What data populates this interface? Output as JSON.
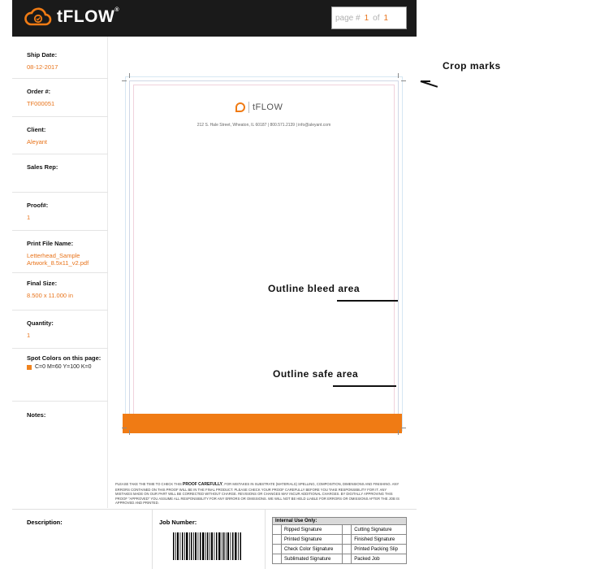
{
  "header": {
    "brand": "tFLOW",
    "page_label": "page #",
    "page_current": "1",
    "page_of_label": "of",
    "page_total": "1"
  },
  "sidebar": {
    "ship_date_label": "Ship Date:",
    "ship_date": "08-12-2017",
    "order_label": "Order #:",
    "order": "TF000051",
    "client_label": "Client:",
    "client": "Aleyant",
    "sales_rep_label": "Sales Rep:",
    "sales_rep": "",
    "proof_label": "Proof#:",
    "proof": "1",
    "print_file_label": "Print File Name:",
    "print_file_line1": "Letterhead_Sample",
    "print_file_line2": "Artwork_8.5x11_v2.pdf",
    "final_size_label": "Final Size:",
    "final_size": "8.500 x 11.000 in",
    "quantity_label": "Quantity:",
    "quantity": "1",
    "spot_label": "Spot Colors on this page:",
    "spot_value": "C=0 M=60 Y=100 K=0",
    "notes_label": "Notes:"
  },
  "document": {
    "brand": "tFLOW",
    "address": "212 S. Hale Street, Wheaton, IL 60187  |  800.571.2139  |  info@aleyant.com"
  },
  "annotations": {
    "crop_marks": "Crop marks",
    "bleed": "Outline bleed area",
    "safe": "Outline safe area"
  },
  "disclaimer": {
    "intro": "Please take the time to check this",
    "emph": "PROOF CAREFULLY",
    "body": ", for mistakes in substrate (materials) spelling, composition, dimensions and finishing. Any errors contained on this proof will be in the final product. Please check your proof carefully before you take responsibility for it. Any mistakes made on our part will be corrected without charge. Revisions or changes may incur additional charges. By digitally approving this proof \"Approved\" you assume all responsibility for any errors or omissions. We will not be held liable for errors or omissions after the job is Approved and printed."
  },
  "bottom": {
    "description_label": "Description:",
    "job_number_label": "Job Number:",
    "internal_header": "Internal Use Only:",
    "rows": [
      [
        "Ripped Signature",
        "Cutting Signature"
      ],
      [
        "Printed Signature",
        "Finished Signature"
      ],
      [
        "Check Color Signature",
        "Printed Packing Slip"
      ],
      [
        "Sublimated Signature",
        "Packed Job"
      ]
    ]
  },
  "colors": {
    "accent": "#f07b14",
    "header_bg": "#1a1a1a"
  }
}
